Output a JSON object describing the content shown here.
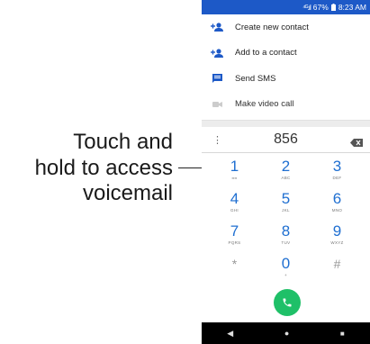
{
  "callout": {
    "lines": [
      "Touch and",
      "hold to access",
      "voicemail"
    ]
  },
  "status": {
    "signal": "⁴ᴳ.ıl",
    "battery": "67%",
    "time": "8:23 AM"
  },
  "menu": [
    {
      "label": "Create new contact",
      "icon": "add-person-icon"
    },
    {
      "label": "Add to a contact",
      "icon": "add-person-icon"
    },
    {
      "label": "Send SMS",
      "icon": "message-icon"
    },
    {
      "label": "Make video call",
      "icon": "video-icon"
    }
  ],
  "dialer": {
    "number": "856",
    "more_icon": "⋮",
    "keys": [
      {
        "digit": "1",
        "letters": "ᴑᴑ"
      },
      {
        "digit": "2",
        "letters": "ABC"
      },
      {
        "digit": "3",
        "letters": "DEF"
      },
      {
        "digit": "4",
        "letters": "GHI"
      },
      {
        "digit": "5",
        "letters": "JKL"
      },
      {
        "digit": "6",
        "letters": "MNO"
      },
      {
        "digit": "7",
        "letters": "PQRS"
      },
      {
        "digit": "8",
        "letters": "TUV"
      },
      {
        "digit": "9",
        "letters": "WXYZ"
      },
      {
        "digit": "*",
        "letters": ""
      },
      {
        "digit": "0",
        "letters": "+"
      },
      {
        "digit": "#",
        "letters": ""
      }
    ]
  },
  "nav": {
    "back": "◀",
    "home": "●",
    "recents": "■"
  },
  "colors": {
    "accent": "#1d59c7",
    "call": "#1fc068",
    "digits": "#1f6fd1"
  }
}
